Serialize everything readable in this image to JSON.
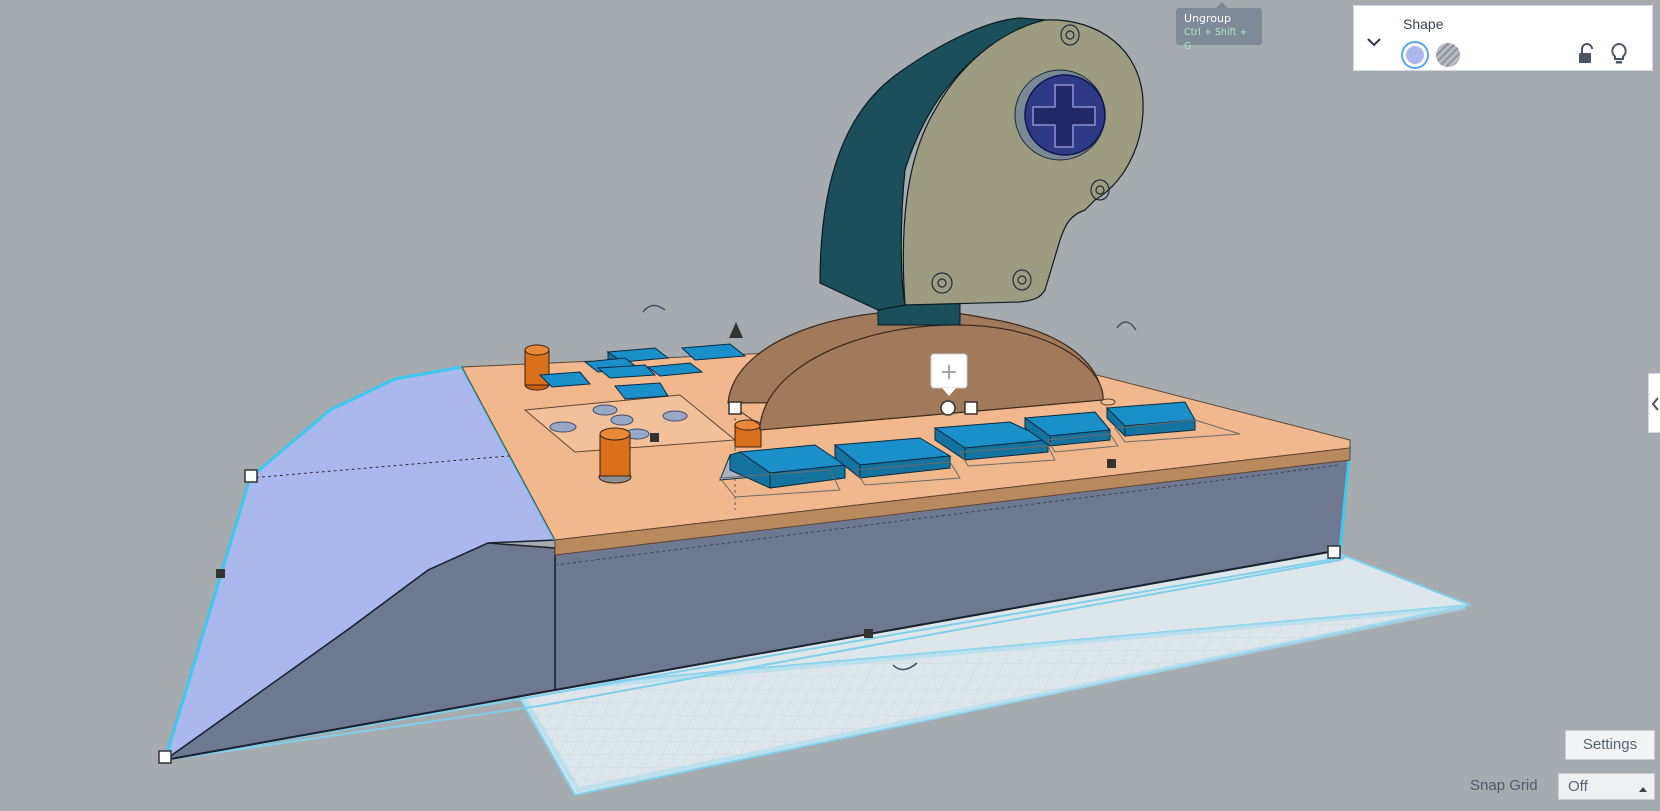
{
  "tooltip": {
    "title": "Ungroup",
    "shortcut": "Ctrl + Shift + G"
  },
  "inspector": {
    "title": "Shape",
    "solid_color": "#aab8ee",
    "icons": [
      "chevron-down-icon",
      "lock-icon",
      "lightbulb-icon"
    ]
  },
  "viewport": {
    "add_icon": "+",
    "colors": {
      "ground": "#a6abb0",
      "board_top": "#f0b88c",
      "board_edge": "#b98a5e",
      "case_side": "#6e7890",
      "selected_face": "#aab8ee",
      "selection_outline": "#3ec8ee",
      "keycap": "#1a8fc9",
      "knob": "#d9701c",
      "joystick_shell": "#1c4f5c",
      "joystick_face": "#9e9c80",
      "workplane": "#dde6ea"
    }
  },
  "settings_label": "Settings",
  "snap_grid": {
    "label": "Snap Grid",
    "value": "Off"
  }
}
